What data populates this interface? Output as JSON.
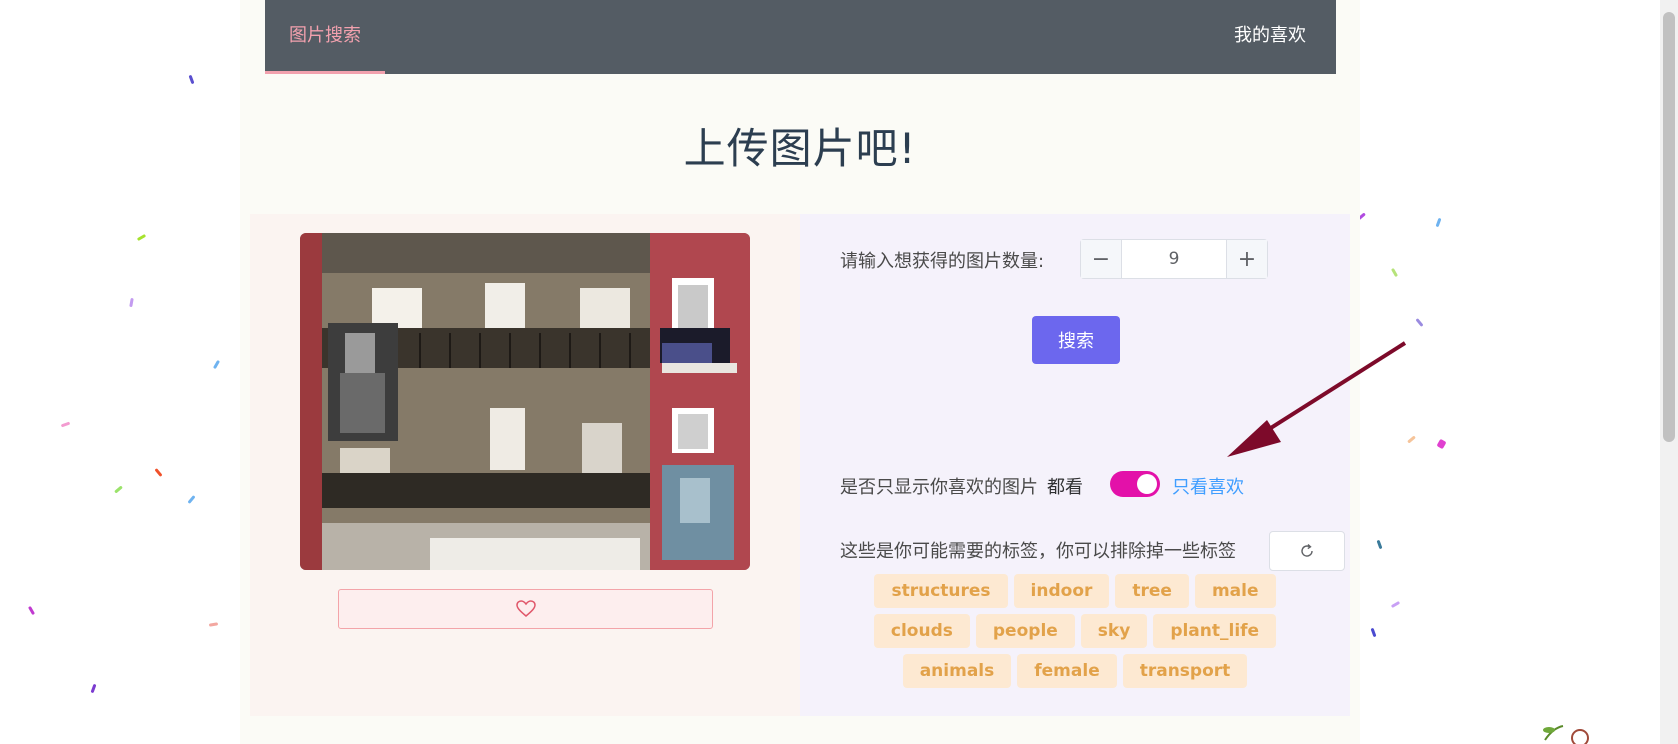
{
  "nav": {
    "search_tab": "图片搜索",
    "favorites_link": "我的喜欢"
  },
  "headline": "上传图片吧!",
  "count": {
    "label": "请输入想获得的图片数量:",
    "value": "9",
    "minus": "−",
    "plus": "+"
  },
  "search_button": "搜索",
  "filter": {
    "label": "是否只显示你喜欢的图片",
    "off_label": "都看",
    "on_label": "只看喜欢",
    "enabled": true
  },
  "tags": {
    "label": "这些是你可能需要的标签，你可以排除掉一些标签",
    "items": [
      "structures",
      "indoor",
      "tree",
      "male",
      "clouds",
      "people",
      "sky",
      "plant_life",
      "animals",
      "female",
      "transport"
    ]
  },
  "colors": {
    "nav_bg": "#545c64",
    "nav_active": "#f2a1ae",
    "primary": "#6c67ee",
    "switch_on": "#e311a9",
    "tag_bg": "#fde9d2",
    "tag_text": "#e2a24a",
    "arrow": "#7d0a2a"
  }
}
